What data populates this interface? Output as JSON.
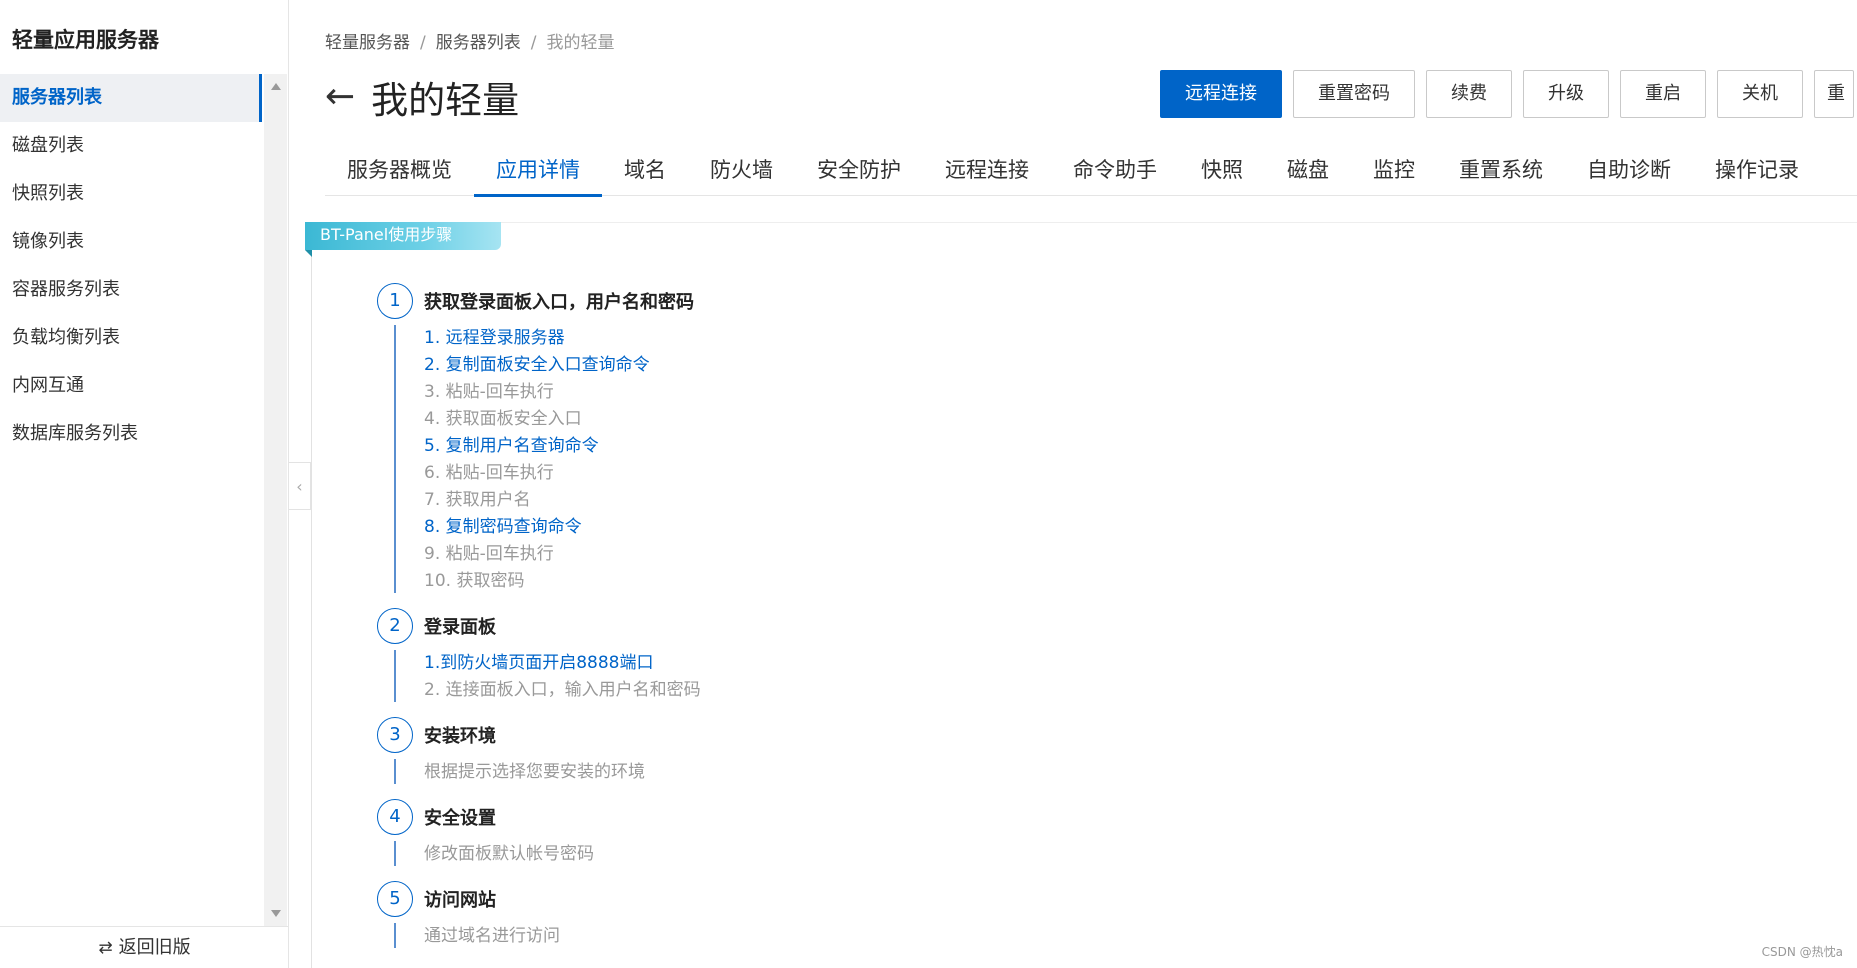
{
  "sidebar": {
    "title": "轻量应用服务器",
    "items": [
      {
        "label": "服务器列表",
        "active": true
      },
      {
        "label": "磁盘列表"
      },
      {
        "label": "快照列表"
      },
      {
        "label": "镜像列表"
      },
      {
        "label": "容器服务列表"
      },
      {
        "label": "负载均衡列表"
      },
      {
        "label": "内网互通"
      },
      {
        "label": "数据库服务列表"
      }
    ],
    "footer_label": "返回旧版"
  },
  "breadcrumb": {
    "items": [
      "轻量服务器",
      "服务器列表",
      "我的轻量"
    ],
    "separator": "/"
  },
  "header": {
    "title": "我的轻量",
    "actions": [
      "远程连接",
      "重置密码",
      "续费",
      "升级",
      "重启",
      "关机",
      "重"
    ]
  },
  "tabs": [
    "服务器概览",
    "应用详情",
    "域名",
    "防火墙",
    "安全防护",
    "远程连接",
    "命令助手",
    "快照",
    "磁盘",
    "监控",
    "重置系统",
    "自助诊断",
    "操作记录"
  ],
  "active_tab": "应用详情",
  "panel": {
    "ribbon": "BT-Panel使用步骤",
    "steps": [
      {
        "num": "1",
        "title": "获取登录面板入口，用户名和密码",
        "items": [
          {
            "text": "1. 远程登录服务器",
            "link": true
          },
          {
            "text": "2. 复制面板安全入口查询命令",
            "link": true
          },
          {
            "text": "3. 粘贴-回车执行",
            "link": false
          },
          {
            "text": "4. 获取面板安全入口",
            "link": false
          },
          {
            "text": "5. 复制用户名查询命令",
            "link": true
          },
          {
            "text": "6. 粘贴-回车执行",
            "link": false
          },
          {
            "text": "7. 获取用户名",
            "link": false
          },
          {
            "text": "8. 复制密码查询命令",
            "link": true
          },
          {
            "text": "9. 粘贴-回车执行",
            "link": false
          },
          {
            "text": "10. 获取密码",
            "link": false
          }
        ]
      },
      {
        "num": "2",
        "title": "登录面板",
        "items": [
          {
            "text": "1.到防火墙页面开启8888端口",
            "link": true
          },
          {
            "text": "2. 连接面板入口，输入用户名和密码",
            "link": false
          }
        ]
      },
      {
        "num": "3",
        "title": "安装环境",
        "items": [
          {
            "text": "根据提示选择您要安装的环境",
            "link": false
          }
        ]
      },
      {
        "num": "4",
        "title": "安全设置",
        "items": [
          {
            "text": "修改面板默认帐号密码",
            "link": false
          }
        ]
      },
      {
        "num": "5",
        "title": "访问网站",
        "items": [
          {
            "text": "通过域名进行访问",
            "link": false
          }
        ]
      }
    ]
  },
  "watermark": "CSDN @热忱a",
  "colors": {
    "accent": "#0064c8",
    "ribbon": "#3bb8d4"
  },
  "icons": {
    "back": "arrow-left-icon",
    "collapse": "chevron-left-icon",
    "footer": "swap-icon"
  }
}
